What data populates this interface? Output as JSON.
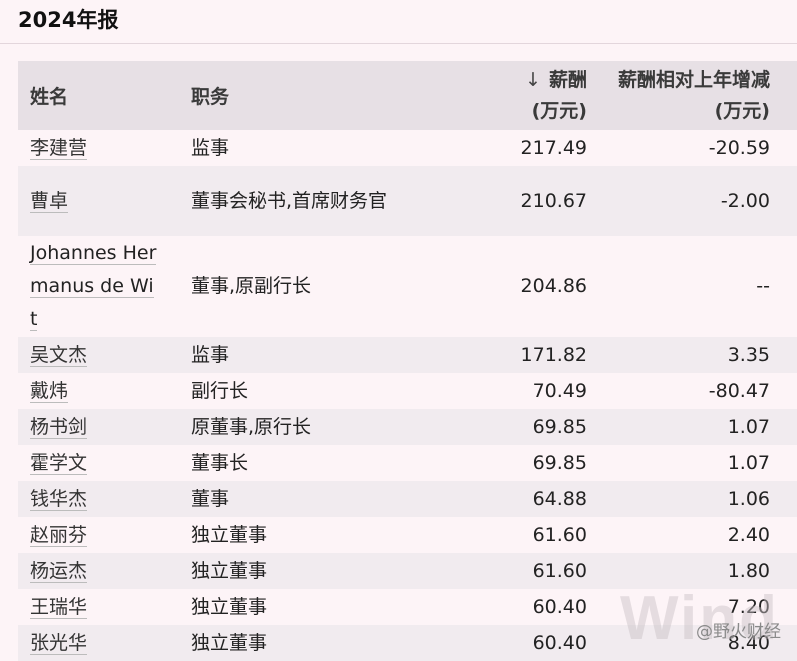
{
  "report": {
    "title": "2024年报",
    "headers": {
      "name": "姓名",
      "role": "职务",
      "salary_line1": "薪酬",
      "salary_line2": "(万元)",
      "change_line1": "薪酬相对上年增减",
      "change_line2": "(万元)",
      "sort_icon": "sort-down-arrow-icon"
    },
    "rows": [
      {
        "name": "李建营",
        "role": "监事",
        "salary": "217.49",
        "change": "-20.59"
      },
      {
        "name": "曹卓",
        "role": "董事会秘书,首席财务官",
        "salary": "210.67",
        "change": "-2.00"
      },
      {
        "name": "Johannes Hermanus de Wit",
        "role": "董事,原副行长",
        "salary": "204.86",
        "change": "--"
      },
      {
        "name": "吴文杰",
        "role": "监事",
        "salary": "171.82",
        "change": "3.35"
      },
      {
        "name": "戴炜",
        "role": "副行长",
        "salary": "70.49",
        "change": "-80.47"
      },
      {
        "name": "杨书剑",
        "role": "原董事,原行长",
        "salary": "69.85",
        "change": "1.07"
      },
      {
        "name": "霍学文",
        "role": "董事长",
        "salary": "69.85",
        "change": "1.07"
      },
      {
        "name": "钱华杰",
        "role": "董事",
        "salary": "64.88",
        "change": "1.06"
      },
      {
        "name": "赵丽芬",
        "role": "独立董事",
        "salary": "61.60",
        "change": "2.40"
      },
      {
        "name": "杨运杰",
        "role": "独立董事",
        "salary": "61.60",
        "change": "1.80"
      },
      {
        "name": "王瑞华",
        "role": "独立董事",
        "salary": "60.40",
        "change": "7.20"
      },
      {
        "name": "张光华",
        "role": "独立董事",
        "salary": "60.40",
        "change": "8.40"
      }
    ]
  },
  "watermark": "Wind",
  "credit": "@野火财经"
}
